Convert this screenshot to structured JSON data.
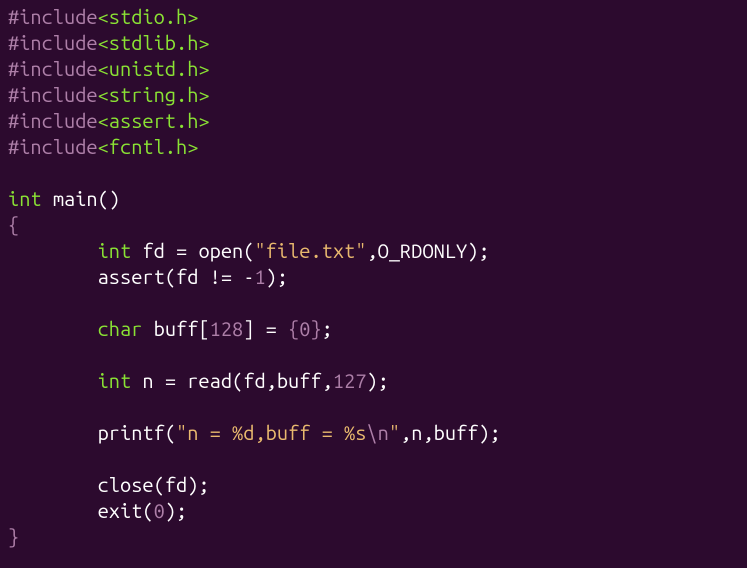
{
  "code": {
    "include1_hash": "#include",
    "include1_header": "<stdio.h>",
    "include2_hash": "#include",
    "include2_header": "<stdlib.h>",
    "include3_hash": "#include",
    "include3_header": "<unistd.h>",
    "include4_hash": "#include",
    "include4_header": "<string.h>",
    "include5_hash": "#include",
    "include5_header": "<assert.h>",
    "include6_hash": "#include",
    "include6_header": "<fcntl.h>",
    "int_kw": "int",
    "main_fn": "main",
    "open_paren": "(",
    "close_paren": ")",
    "open_brace": "{",
    "close_brace": "}",
    "fd_var": "fd",
    "eq": " = ",
    "open_fn": "open",
    "file_str": "\"file.txt\"",
    "comma": ",",
    "o_rdonly": "O_RDONLY",
    "semi": ";",
    "assert_fn": "assert",
    "neq": " != ",
    "neg1": "-1",
    "one": "1",
    "minus": "-",
    "char_kw": "char",
    "buff_var": "buff",
    "open_bracket": "[",
    "close_bracket": "]",
    "num128": "128",
    "num0": "0",
    "n_var": "n",
    "read_fn": "read",
    "num127": "127",
    "printf_fn": "printf",
    "printf_str1": "\"n = %d,buff = %s",
    "escape_n": "\\n",
    "printf_str2": "\"",
    "close_fn": "close",
    "exit_fn": "exit",
    "indent": "        "
  }
}
